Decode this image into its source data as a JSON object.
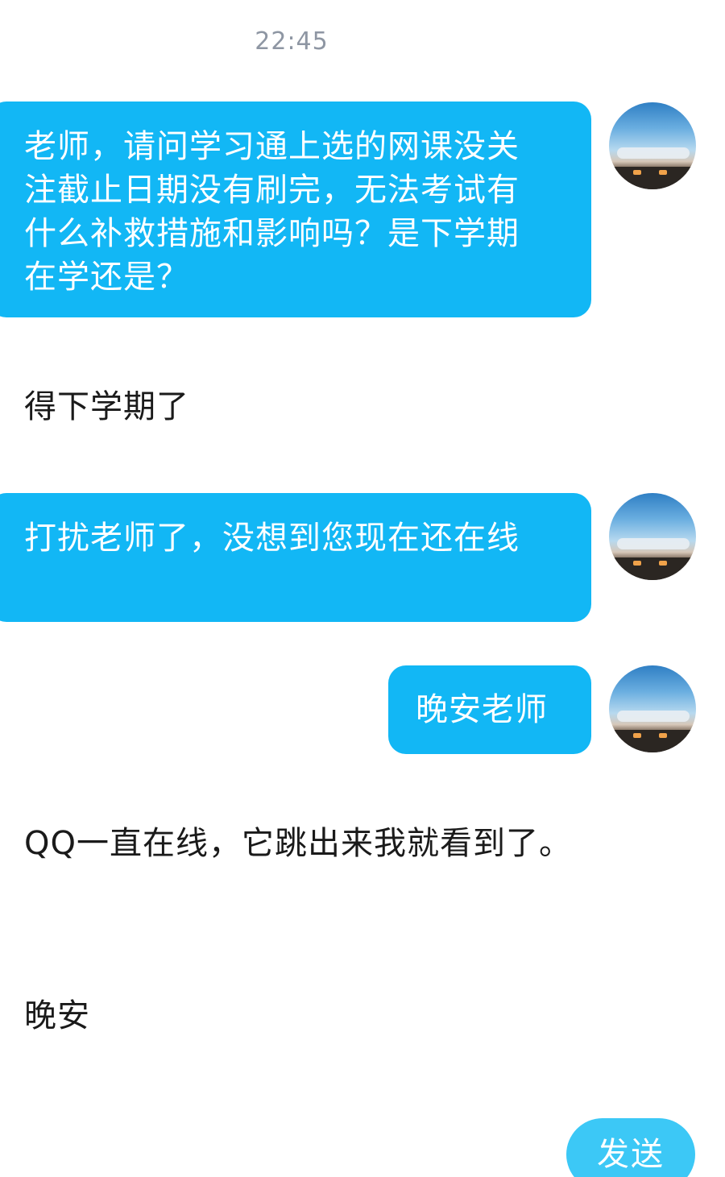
{
  "chat": {
    "timestamp": "22:45",
    "messages": [
      {
        "side": "outgoing",
        "text": "老师，请问学习通上选的网课没关注截止日期没有刷完，无法考试有什么补救措施和影响吗？是下学期在学还是？"
      },
      {
        "side": "incoming",
        "text": "得下学期了"
      },
      {
        "side": "outgoing",
        "text": "打扰老师了，没想到您现在还在线"
      },
      {
        "side": "outgoing",
        "text": "晚安老师"
      },
      {
        "side": "incoming",
        "text": "QQ一直在线，它跳出来我就看到了。"
      },
      {
        "side": "incoming",
        "text": "晚安"
      }
    ]
  },
  "composer": {
    "send_label": "发送"
  },
  "colors": {
    "outgoing_bubble": "#12b7f5",
    "send_button": "#3cc8f6",
    "timestamp": "#8e96a3"
  },
  "icons": {
    "avatar": "user-avatar-landscape-photo"
  }
}
